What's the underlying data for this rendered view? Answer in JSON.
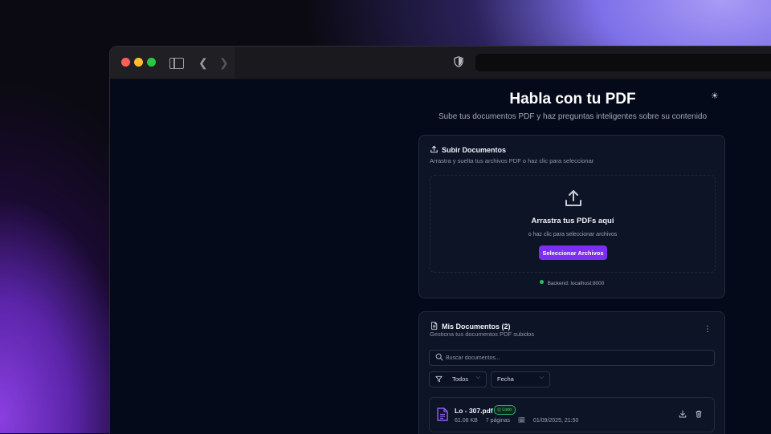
{
  "header": {
    "title": "Habla con tu PDF",
    "subtitle": "Sube tus documentos PDF y haz preguntas inteligentes sobre su contenido"
  },
  "upload_card": {
    "title": "Subir Documentos",
    "subtitle": "Arrastra y suelta tus archivos PDF o haz clic para seleccionar",
    "drop_title": "Arrastra tus PDFs aquí",
    "drop_subtitle": "o haz clic para seleccionar archivos",
    "select_button": "Seleccionar Archivos",
    "backend_status": "Backend: localhost:8000"
  },
  "docs_card": {
    "title": "Mis Documentos (2)",
    "subtitle": "Gestiona tus documentos PDF subidos",
    "search_placeholder": "Buscar documentos...",
    "filter_status": "Todos",
    "filter_sort": "Fecha",
    "documents": [
      {
        "name": "Lo - 307.pdf",
        "status": "Listo",
        "size": "61.08 KB",
        "pages": "7 páginas",
        "date": "01/09/2025, 21:50"
      }
    ]
  },
  "colors": {
    "accent": "#7c2ff0",
    "status_ok": "#22c55e",
    "background": "#050a1a"
  }
}
